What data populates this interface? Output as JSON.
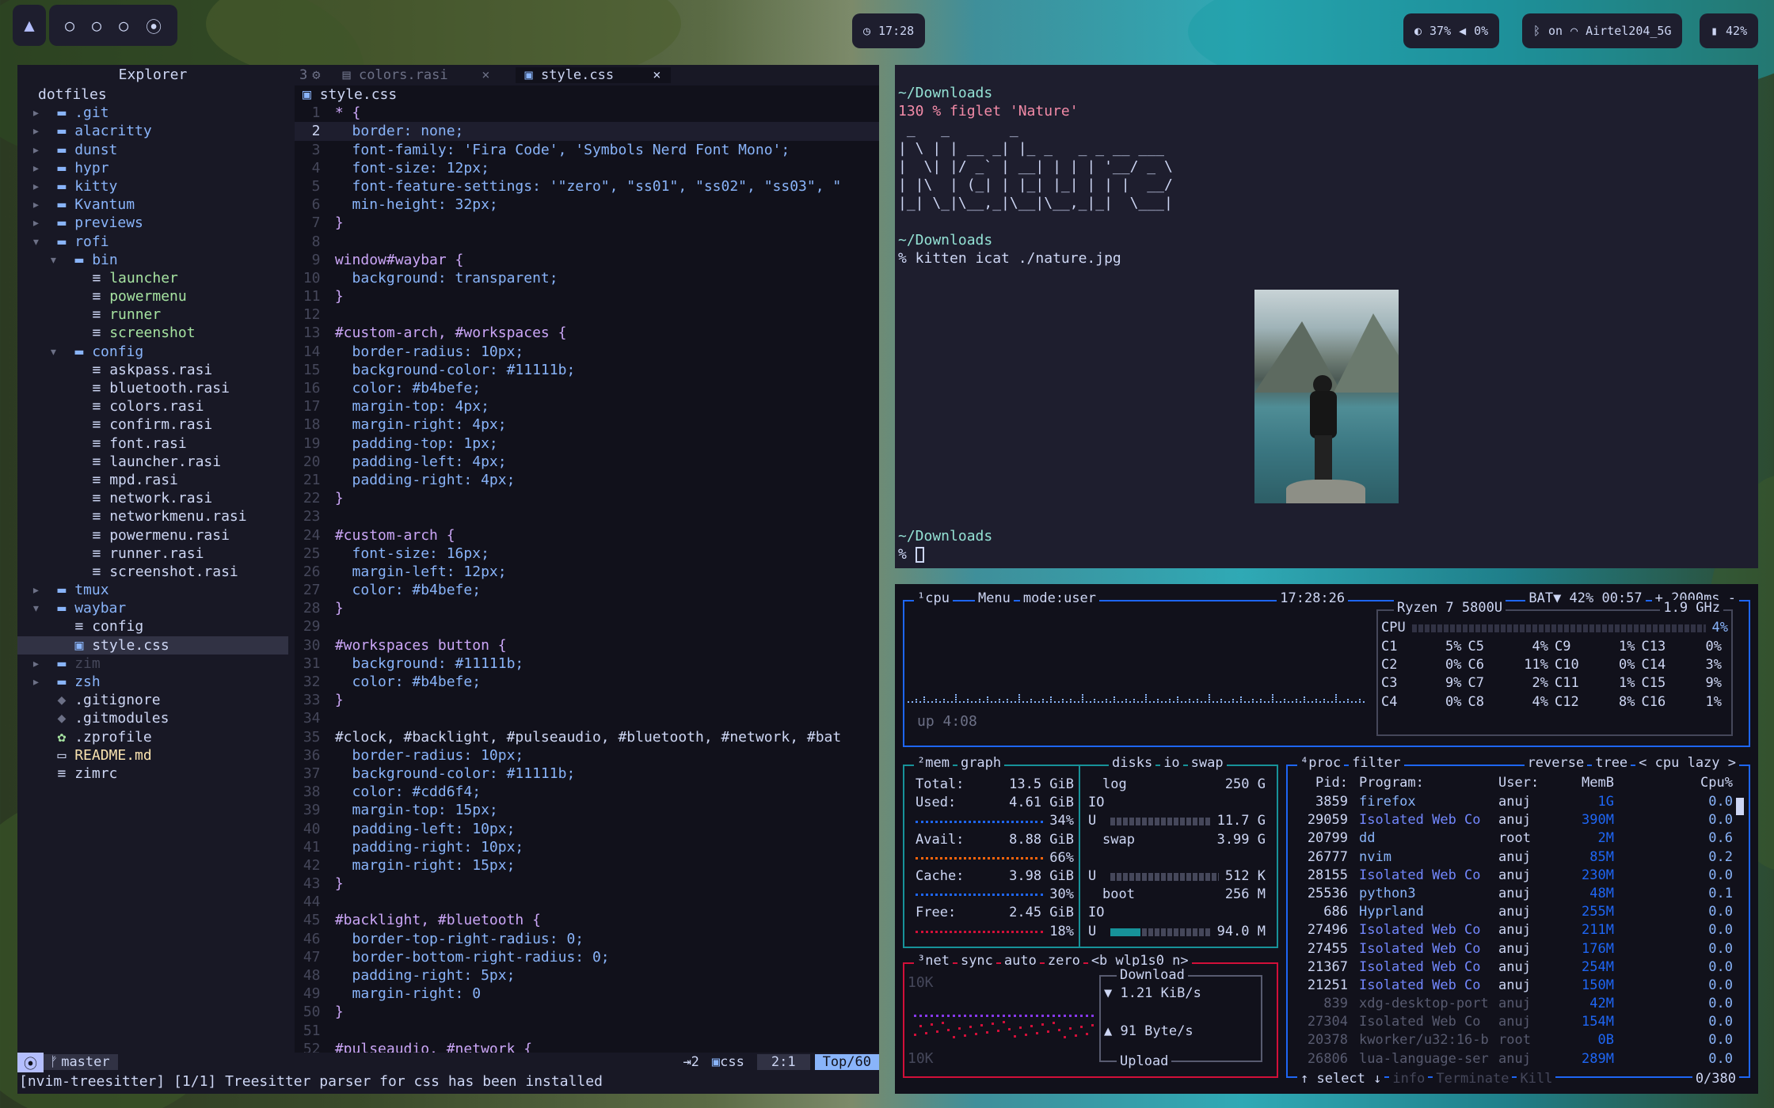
{
  "topbar": {
    "workspace_icon": "arch-logo-icon",
    "workspaces": [
      "○",
      "○",
      "○",
      "⦿"
    ],
    "clock": "17:28",
    "brightness": "37%",
    "volume": "0%",
    "bluetooth": "on",
    "network": "Airtel204_5G",
    "battery": "42%"
  },
  "explorer": {
    "title": "Explorer",
    "root": "dotfiles",
    "items": [
      {
        "d": 0,
        "arrow": "▸",
        "icon": "folder",
        "name": ".git",
        "c": "blu"
      },
      {
        "d": 0,
        "arrow": "▸",
        "icon": "folder",
        "name": "alacritty",
        "c": "blu"
      },
      {
        "d": 0,
        "arrow": "▸",
        "icon": "folder",
        "name": "dunst",
        "c": "blu"
      },
      {
        "d": 0,
        "arrow": "▸",
        "icon": "folder",
        "name": "hypr",
        "c": "blu"
      },
      {
        "d": 0,
        "arrow": "▸",
        "icon": "folder",
        "name": "kitty",
        "c": "blu"
      },
      {
        "d": 0,
        "arrow": "▸",
        "icon": "folder",
        "name": "Kvantum",
        "c": "blu"
      },
      {
        "d": 0,
        "arrow": "▸",
        "icon": "folder",
        "name": "previews",
        "c": "blu"
      },
      {
        "d": 0,
        "arrow": "▾",
        "icon": "folder",
        "name": "rofi",
        "c": "blu"
      },
      {
        "d": 1,
        "arrow": "▾",
        "icon": "folder",
        "name": "bin",
        "c": "blu"
      },
      {
        "d": 2,
        "arrow": "",
        "icon": "file",
        "name": "launcher",
        "c": "grn"
      },
      {
        "d": 2,
        "arrow": "",
        "icon": "file",
        "name": "powermenu",
        "c": "grn"
      },
      {
        "d": 2,
        "arrow": "",
        "icon": "file",
        "name": "runner",
        "c": "grn"
      },
      {
        "d": 2,
        "arrow": "",
        "icon": "file",
        "name": "screenshot",
        "c": "grn"
      },
      {
        "d": 1,
        "arrow": "▾",
        "icon": "folder",
        "name": "config",
        "c": "blu"
      },
      {
        "d": 2,
        "arrow": "",
        "icon": "file",
        "name": "askpass.rasi",
        "c": ""
      },
      {
        "d": 2,
        "arrow": "",
        "icon": "file",
        "name": "bluetooth.rasi",
        "c": ""
      },
      {
        "d": 2,
        "arrow": "",
        "icon": "file",
        "name": "colors.rasi",
        "c": ""
      },
      {
        "d": 2,
        "arrow": "",
        "icon": "file",
        "name": "confirm.rasi",
        "c": ""
      },
      {
        "d": 2,
        "arrow": "",
        "icon": "file",
        "name": "font.rasi",
        "c": ""
      },
      {
        "d": 2,
        "arrow": "",
        "icon": "file",
        "name": "launcher.rasi",
        "c": ""
      },
      {
        "d": 2,
        "arrow": "",
        "icon": "file",
        "name": "mpd.rasi",
        "c": ""
      },
      {
        "d": 2,
        "arrow": "",
        "icon": "file",
        "name": "network.rasi",
        "c": ""
      },
      {
        "d": 2,
        "arrow": "",
        "icon": "file",
        "name": "networkmenu.rasi",
        "c": ""
      },
      {
        "d": 2,
        "arrow": "",
        "icon": "file",
        "name": "powermenu.rasi",
        "c": ""
      },
      {
        "d": 2,
        "arrow": "",
        "icon": "file",
        "name": "runner.rasi",
        "c": ""
      },
      {
        "d": 2,
        "arrow": "",
        "icon": "file",
        "name": "screenshot.rasi",
        "c": ""
      },
      {
        "d": 0,
        "arrow": "▸",
        "icon": "folder",
        "name": "tmux",
        "c": "blu"
      },
      {
        "d": 0,
        "arrow": "▾",
        "icon": "folder",
        "name": "waybar",
        "c": "blu"
      },
      {
        "d": 1,
        "arrow": "",
        "icon": "file",
        "name": "config",
        "c": ""
      },
      {
        "d": 1,
        "arrow": "",
        "icon": "css",
        "name": "style.css",
        "c": "",
        "sel": true
      },
      {
        "d": 0,
        "arrow": "▸",
        "icon": "folder",
        "name": "zim",
        "c": "dim"
      },
      {
        "d": 0,
        "arrow": "▸",
        "icon": "folder",
        "name": "zsh",
        "c": "blu"
      },
      {
        "d": 0,
        "arrow": "",
        "icon": "git",
        "name": ".gitignore",
        "c": ""
      },
      {
        "d": 0,
        "arrow": "",
        "icon": "git",
        "name": ".gitmodules",
        "c": ""
      },
      {
        "d": 0,
        "arrow": "",
        "icon": "gear",
        "name": ".zprofile",
        "c": ""
      },
      {
        "d": 0,
        "arrow": "",
        "icon": "md",
        "name": "README.md",
        "c": "yel"
      },
      {
        "d": 0,
        "arrow": "",
        "icon": "file",
        "name": "zimrc",
        "c": ""
      }
    ]
  },
  "editor": {
    "tab_count": "3",
    "tabs": [
      {
        "name": "colors.rasi",
        "active": false
      },
      {
        "name": "style.css",
        "active": true
      }
    ],
    "tab_close": "×",
    "filename": "style.css",
    "lines": [
      [
        "* {"
      ],
      [
        "  border: none;"
      ],
      [
        "  font-family: 'Fira Code', 'Symbols Nerd Font Mono';"
      ],
      [
        "  font-size: 12px;"
      ],
      [
        "  font-feature-settings: '\"zero\", \"ss01\", \"ss02\", \"ss03\", \""
      ],
      [
        "  min-height: 32px;"
      ],
      [
        "}"
      ],
      [
        ""
      ],
      [
        "window#waybar {"
      ],
      [
        "  background: transparent;"
      ],
      [
        "}"
      ],
      [
        ""
      ],
      [
        "#custom-arch, #workspaces {"
      ],
      [
        "  border-radius: 10px;"
      ],
      [
        "  background-color: #11111b;"
      ],
      [
        "  color: #b4befe;"
      ],
      [
        "  margin-top: 4px;"
      ],
      [
        "  margin-right: 4px;"
      ],
      [
        "  padding-top: 1px;"
      ],
      [
        "  padding-left: 4px;"
      ],
      [
        "  padding-right: 4px;"
      ],
      [
        "}"
      ],
      [
        ""
      ],
      [
        "#custom-arch {"
      ],
      [
        "  font-size: 16px;"
      ],
      [
        "  margin-left: 12px;"
      ],
      [
        "  color: #b4befe;"
      ],
      [
        "}"
      ],
      [
        ""
      ],
      [
        "#workspaces button {"
      ],
      [
        "  background: #11111b;"
      ],
      [
        "  color: #b4befe;"
      ],
      [
        "}"
      ],
      [
        ""
      ],
      [
        "#clock, #backlight, #pulseaudio, #bluetooth, #network, #bat"
      ],
      [
        "  border-radius: 10px;"
      ],
      [
        "  background-color: #11111b;"
      ],
      [
        "  color: #cdd6f4;"
      ],
      [
        "  margin-top: 15px;"
      ],
      [
        "  padding-left: 10px;"
      ],
      [
        "  padding-right: 10px;"
      ],
      [
        "  margin-right: 15px;"
      ],
      [
        "}"
      ],
      [
        ""
      ],
      [
        "#backlight, #bluetooth {"
      ],
      [
        "  border-top-right-radius: 0;"
      ],
      [
        "  border-bottom-right-radius: 0;"
      ],
      [
        "  padding-right: 5px;"
      ],
      [
        "  margin-right: 0"
      ],
      [
        "}"
      ],
      [
        ""
      ],
      [
        "#pulseaudio, #network {"
      ]
    ],
    "status": {
      "mode_icon": "⦿",
      "branch": "master",
      "lsp": "2",
      "lang": "css",
      "pos": "2:1",
      "scroll": "Top/60"
    },
    "message": "[nvim-treesitter] [1/1] Treesitter parser for css has been installed"
  },
  "terminal": {
    "lines": [
      {
        "t": "~/Downloads",
        "c": "teal"
      },
      {
        "t": "130 % figlet 'Nature'",
        "c": "red"
      },
      {
        "t": " _   _       _                  ",
        "c": ""
      },
      {
        "t": "| \\ | | __ _| |_ _   _ _ __ ___ ",
        "c": ""
      },
      {
        "t": "|  \\| |/ _` | __| | | | '__/ _ \\",
        "c": ""
      },
      {
        "t": "| |\\  | (_| | |_| |_| | | |  __/",
        "c": ""
      },
      {
        "t": "|_| \\_|\\__,_|\\__|\\__,_|_|  \\___|",
        "c": ""
      },
      {
        "t": "",
        "c": ""
      },
      {
        "t": "~/Downloads",
        "c": "teal"
      },
      {
        "t": "% kitten icat ./nature.jpg",
        "c": ""
      }
    ],
    "prompt_dir": "~/Downloads",
    "prompt": "% "
  },
  "btop": {
    "cpu": {
      "label": "¹cpu",
      "menu": "Menu",
      "mode": "mode:user",
      "time": "17:28:26",
      "bat": "BAT▼ 42% 00:57",
      "interval": "+ 2000ms -",
      "model": "Ryzen 7 5800U",
      "freq": "1.9 GHz",
      "total_label": "CPU",
      "total": "4%",
      "uptime": "up 4:08",
      "cores": [
        [
          "C1",
          "5%"
        ],
        [
          "C5",
          "4%"
        ],
        [
          "C9",
          "1%"
        ],
        [
          "C13",
          "0%"
        ],
        [
          "C2",
          "0%"
        ],
        [
          "C6",
          "11%"
        ],
        [
          "C10",
          "0%"
        ],
        [
          "C14",
          "3%"
        ],
        [
          "C3",
          "9%"
        ],
        [
          "C7",
          "2%"
        ],
        [
          "C11",
          "1%"
        ],
        [
          "C15",
          "9%"
        ],
        [
          "C4",
          "0%"
        ],
        [
          "C8",
          "4%"
        ],
        [
          "C12",
          "8%"
        ],
        [
          "C16",
          "1%"
        ]
      ]
    },
    "mem": {
      "label": "²mem",
      "graph": "graph",
      "total": [
        "Total:",
        "13.5 GiB"
      ],
      "used": [
        "Used:",
        "4.61 GiB",
        "34%"
      ],
      "avail": [
        "Avail:",
        "8.88 GiB",
        "66%"
      ],
      "cache": [
        "Cache:",
        "3.98 GiB",
        "30%"
      ],
      "free": [
        "Free:",
        "2.45 GiB",
        "18%"
      ]
    },
    "disks": {
      "label": "disks",
      "io": "io",
      "swap": "swap",
      "entries": [
        {
          "name": "log",
          "size": "250 G",
          "io": "IO",
          "used": "11.7 G"
        },
        {
          "name": "swap",
          "size": "3.99 G",
          "io": "",
          "used": "512 K"
        },
        {
          "name": "boot",
          "size": "256 M",
          "io": "IO",
          "used": "94.0 M"
        }
      ]
    },
    "net": {
      "label": "³net",
      "sync": "sync",
      "auto": "auto",
      "zero": "zero",
      "iface": "<b wlp1s0 n>",
      "scale_top": "10K",
      "scale_bottom": "10K",
      "download_label": "Download",
      "download": "▼ 1.21 KiB/s",
      "upload": "▲ 91 Byte/s",
      "upload_label": "Upload"
    },
    "proc": {
      "label": "⁴proc",
      "filter": "filter",
      "reverse": "reverse",
      "tree": "tree",
      "sort": "< cpu lazy >",
      "headers": [
        "Pid:",
        "Program:",
        "User:",
        "MemB",
        "Cpu%"
      ],
      "rows": [
        [
          "3859",
          "firefox",
          "anuj",
          "1G",
          "0.0"
        ],
        [
          "29059",
          "Isolated Web Co",
          "anuj",
          "390M",
          "0.0"
        ],
        [
          "20799",
          "dd",
          "root",
          "2M",
          "0.6"
        ],
        [
          "26777",
          "nvim",
          "anuj",
          "85M",
          "0.2"
        ],
        [
          "28155",
          "Isolated Web Co",
          "anuj",
          "230M",
          "0.0"
        ],
        [
          "25536",
          "python3",
          "anuj",
          "48M",
          "0.1"
        ],
        [
          "686",
          "Hyprland",
          "anuj",
          "255M",
          "0.0"
        ],
        [
          "27496",
          "Isolated Web Co",
          "anuj",
          "211M",
          "0.0"
        ],
        [
          "27455",
          "Isolated Web Co",
          "anuj",
          "176M",
          "0.0"
        ],
        [
          "21367",
          "Isolated Web Co",
          "anuj",
          "254M",
          "0.0"
        ],
        [
          "21251",
          "Isolated Web Co",
          "anuj",
          "150M",
          "0.0"
        ],
        [
          "839",
          "xdg-desktop-port",
          "anuj",
          "42M",
          "0.0"
        ],
        [
          "27304",
          "Isolated Web Co",
          "anuj",
          "154M",
          "0.0"
        ],
        [
          "20378",
          "kworker/u32:16-b",
          "root",
          "0B",
          "0.0"
        ],
        [
          "26806",
          "lua-language-ser",
          "anuj",
          "289M",
          "0.0"
        ]
      ],
      "footer_select": "select",
      "footer_info": "info",
      "footer_terminate": "Terminate",
      "footer_kill": "Kill",
      "count": "0/380"
    }
  }
}
